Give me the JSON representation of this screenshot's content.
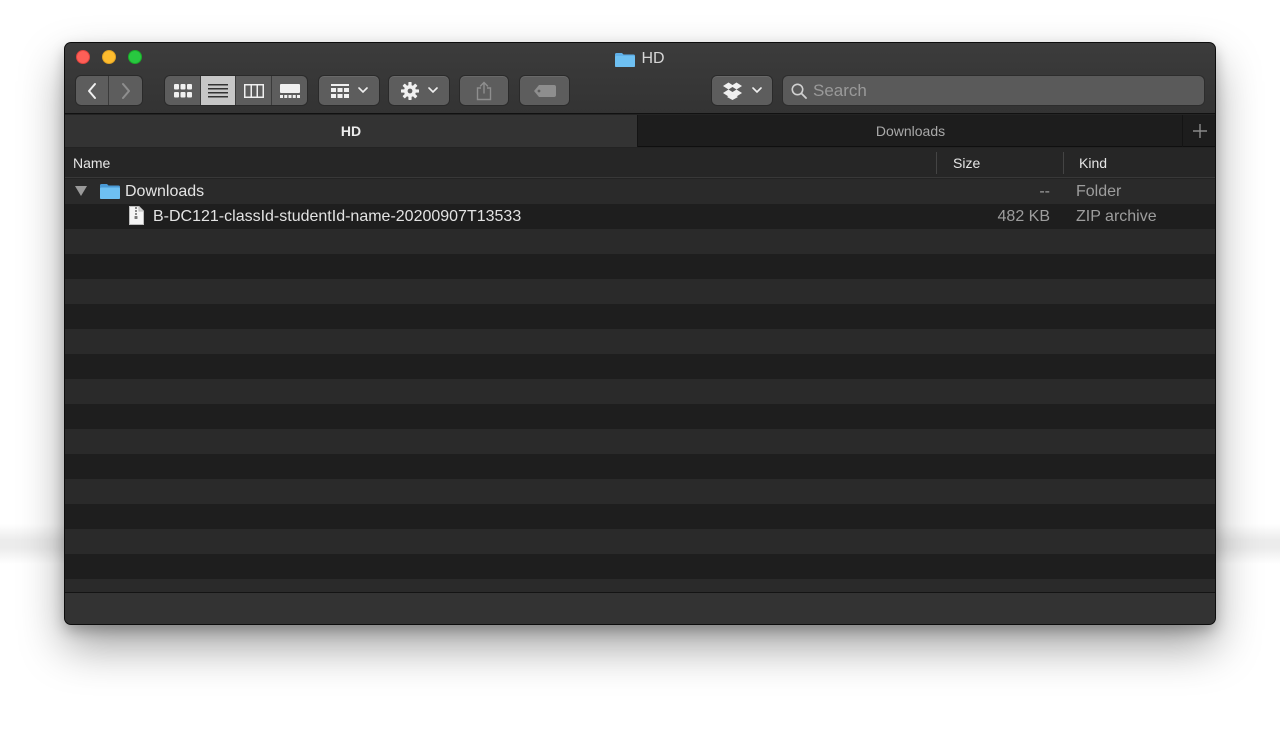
{
  "window": {
    "title": "HD"
  },
  "toolbar": {
    "back_icon": "chevron-left-icon",
    "forward_icon": "chevron-right-icon",
    "view_modes": [
      "icon-view-icon",
      "list-view-icon",
      "column-view-icon",
      "gallery-view-icon"
    ],
    "active_view": "list",
    "group_icon": "group-grid-icon",
    "action_icon": "gear-icon",
    "share_icon": "share-icon",
    "tag_icon": "tag-icon",
    "dropbox_icon": "dropbox-icon"
  },
  "search": {
    "placeholder": "Search",
    "value": ""
  },
  "tabs": [
    {
      "label": "HD",
      "active": true
    },
    {
      "label": "Downloads",
      "active": false
    }
  ],
  "columns": {
    "name": "Name",
    "size": "Size",
    "kind": "Kind"
  },
  "rows": [
    {
      "name": "Downloads",
      "size": "--",
      "kind": "Folder",
      "type": "folder",
      "expanded": true
    },
    {
      "name": "B-DC121-classId-studentId-name-20200907T13533",
      "size": "482 KB",
      "kind": "ZIP archive",
      "type": "file"
    }
  ],
  "colors": {
    "folder_blue": "#5fb0e8",
    "close": "#fe5f57",
    "minimize": "#febc2e",
    "maximize": "#28c840"
  }
}
